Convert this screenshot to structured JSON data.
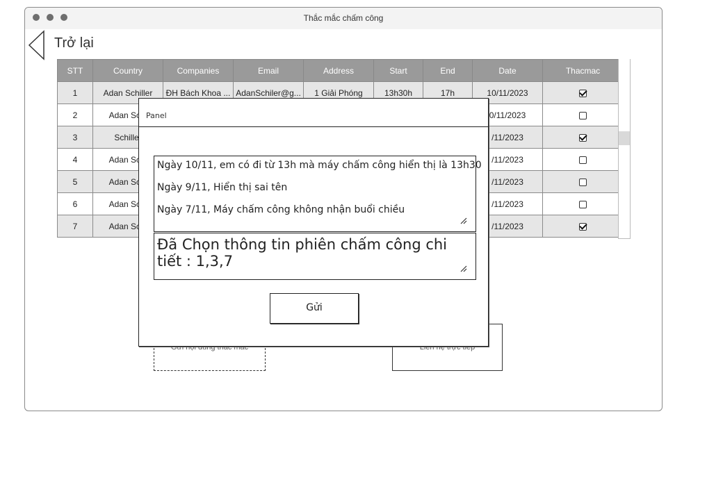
{
  "window": {
    "title": "Thắc mắc chấm công"
  },
  "back": {
    "label": "Trở lại"
  },
  "table": {
    "headers": [
      "STT",
      "Country",
      "Companies",
      "Email",
      "Address",
      "Start",
      "End",
      "Date",
      "Thacmac"
    ],
    "rows": [
      {
        "stt": "1",
        "country": "Adan Schiller",
        "company": "ĐH Bách Khoa ...",
        "email": "AdanSchiler@g...",
        "address": "1 Giải Phóng",
        "start": "13h30h",
        "end": "17h",
        "date": "10/11/2023",
        "checked": true
      },
      {
        "stt": "2",
        "country": "Adan Schi",
        "company": "",
        "email": "",
        "address": "",
        "start": "",
        "end": "",
        "date": "0/11/2023",
        "checked": false
      },
      {
        "stt": "3",
        "country": "Schiller",
        "company": "",
        "email": "",
        "address": "",
        "start": "",
        "end": "",
        "date": "/11/2023",
        "checked": true
      },
      {
        "stt": "4",
        "country": "Adan Schi",
        "company": "",
        "email": "",
        "address": "",
        "start": "",
        "end": "",
        "date": "/11/2023",
        "checked": false
      },
      {
        "stt": "5",
        "country": "Adan Schi",
        "company": "",
        "email": "",
        "address": "",
        "start": "",
        "end": "",
        "date": "/11/2023",
        "checked": false
      },
      {
        "stt": "6",
        "country": "Adan Schi",
        "company": "",
        "email": "",
        "address": "",
        "start": "",
        "end": "",
        "date": "/11/2023",
        "checked": false
      },
      {
        "stt": "7",
        "country": "Adan Schi",
        "company": "",
        "email": "",
        "address": "",
        "start": "",
        "end": "",
        "date": "/11/2023",
        "checked": true
      }
    ]
  },
  "buttons": {
    "send_question": "Gửi nội dung thắc mắc",
    "contact_direct": "Liên hệ trực tiếp"
  },
  "panel": {
    "title": "Panel",
    "lines": [
      "Ngày 10/11, em có đi từ 13h mà máy chấm công hiển thị là 13h30",
      "Ngày 9/11, Hiển thị sai tên",
      "Ngày 7/11, Máy chấm công không nhận buổi chiều"
    ],
    "selected_info": "Đã Chọn thông tin phiên chấm công chi tiết : 1,3,7",
    "send_label": "Gửi"
  }
}
